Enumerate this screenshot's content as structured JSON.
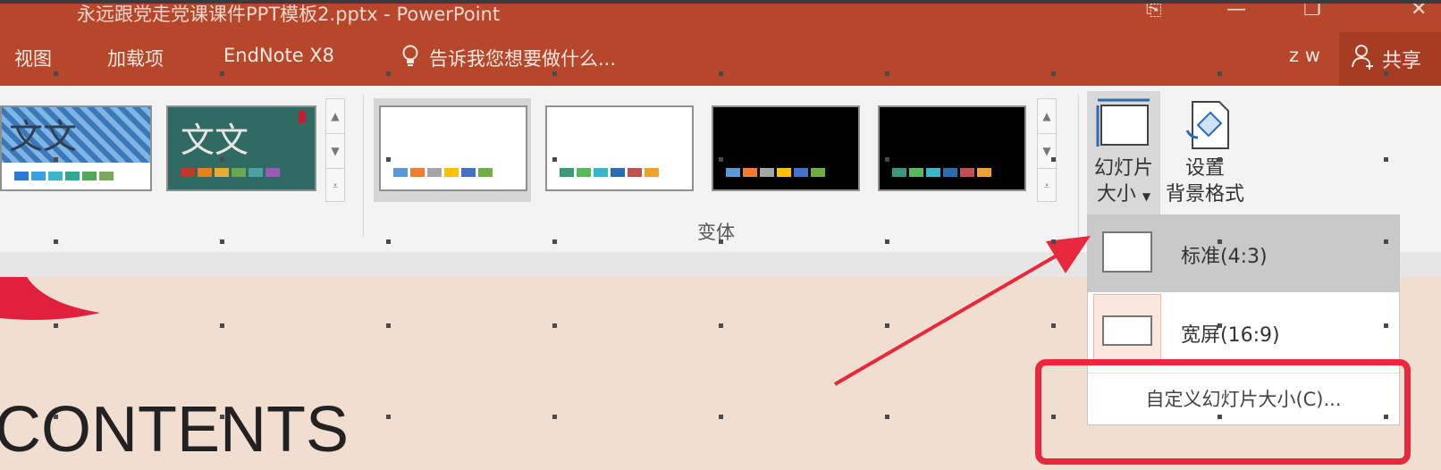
{
  "window": {
    "title": "永远跟党走党课课件PPT模板2.pptx - PowerPoint",
    "controls": [
      "restore-icon",
      "minimize-icon",
      "maximize-icon",
      "close-icon"
    ]
  },
  "tabs": [
    {
      "label": "视图"
    },
    {
      "label": "加载项"
    },
    {
      "label": "EndNote X8"
    }
  ],
  "tell_me": {
    "label": "告诉我您想要做什么..."
  },
  "user": {
    "name": "z w"
  },
  "share": {
    "label": "共享"
  },
  "ribbon": {
    "variants_group_label": "变体",
    "theme_thumb_text": "文文",
    "slide_size_label_line1": "幻灯片",
    "slide_size_label_line2": "大小",
    "format_bg_label_line1": "设置",
    "format_bg_label_line2": "背景格式"
  },
  "dropdown": {
    "items": [
      {
        "label": "标准(4:3)"
      },
      {
        "label": "宽屏(16:9)"
      }
    ],
    "custom_label": "自定义幻灯片大小(C)..."
  },
  "slide": {
    "heading": "CONTENTS"
  },
  "colors": {
    "title_bar": "#b7472a",
    "ribbon_bg": "#f3f3f3",
    "annotation_red": "#e8283c"
  }
}
